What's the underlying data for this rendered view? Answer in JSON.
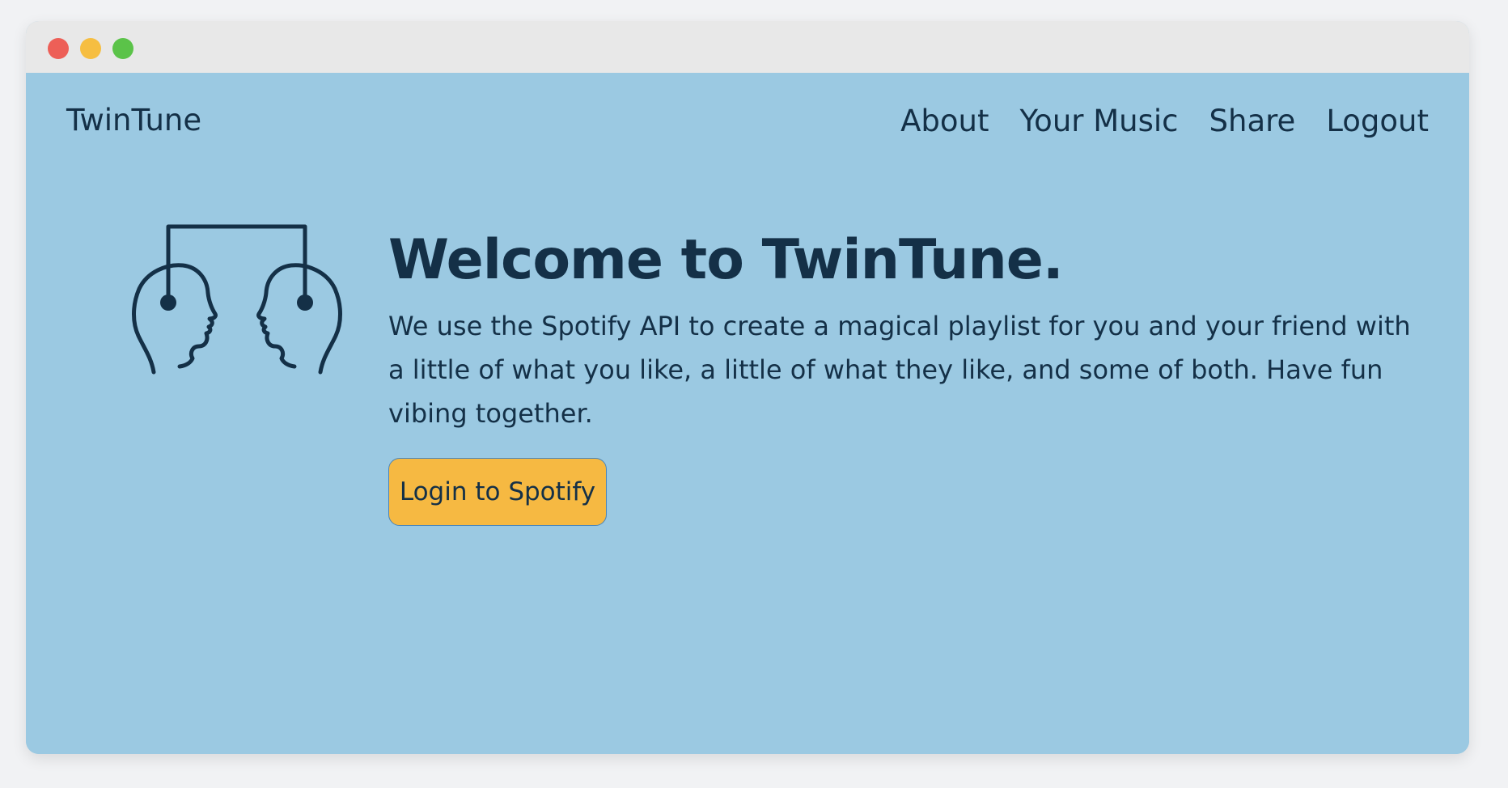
{
  "window": {
    "controls": [
      {
        "name": "close",
        "color": "#ed5f57"
      },
      {
        "name": "minimize",
        "color": "#f6be41"
      },
      {
        "name": "maximize",
        "color": "#5bc349"
      }
    ]
  },
  "header": {
    "brand": "TwinTune",
    "nav": [
      {
        "label": "About"
      },
      {
        "label": "Your Music"
      },
      {
        "label": "Share"
      },
      {
        "label": "Logout"
      }
    ]
  },
  "hero": {
    "logo_icon": "two-heads-headphones-icon",
    "title": "Welcome to TwinTune.",
    "description": "We use the Spotify API to create a magical playlist for you and your friend with a little of what you like, a little of what they like, and some of both. Have fun vibing together.",
    "button_label": "Login to Spotify"
  },
  "colors": {
    "background": "#9bc9e2",
    "text": "#143047",
    "button": "#f6b942",
    "titlebar": "#e8e8e8"
  }
}
